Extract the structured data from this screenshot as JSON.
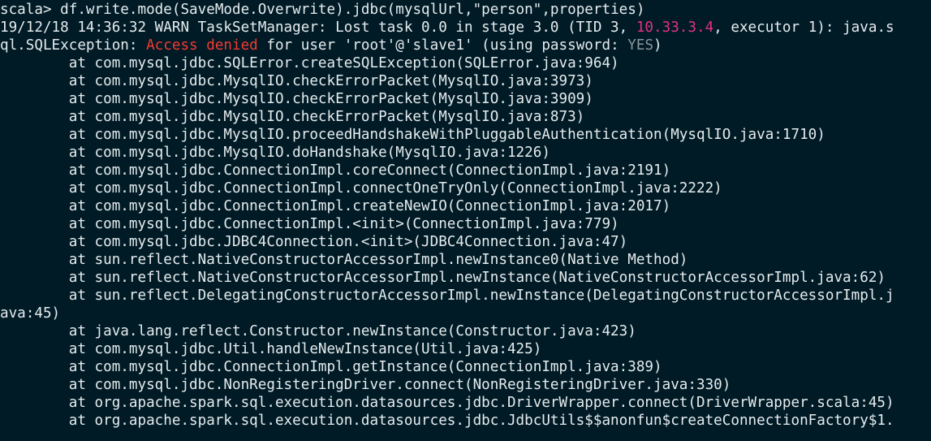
{
  "terminal": {
    "prompt": "scala>",
    "command": " df.write.mode(SaveMode.Overwrite).jdbc(mysqlUrl,\"person\",properties)",
    "warn_line": {
      "prefix": "19/12/18 14:36:32 WARN TaskSetManager: Lost task 0.0 in stage 3.0 (TID 3, ",
      "host": "10.33.3.4",
      "suffix": ", executor 1): java.s"
    },
    "exception_line": {
      "prefix": "ql.SQLException: ",
      "access_denied": "Access denied",
      "middle": " for user 'root'@'slave1' (using password: ",
      "password_flag": "YES",
      "suffix": ")"
    },
    "stack_lines": [
      "        at com.mysql.jdbc.SQLError.createSQLException(SQLError.java:964)",
      "        at com.mysql.jdbc.MysqlIO.checkErrorPacket(MysqlIO.java:3973)",
      "        at com.mysql.jdbc.MysqlIO.checkErrorPacket(MysqlIO.java:3909)",
      "        at com.mysql.jdbc.MysqlIO.checkErrorPacket(MysqlIO.java:873)",
      "        at com.mysql.jdbc.MysqlIO.proceedHandshakeWithPluggableAuthentication(MysqlIO.java:1710)",
      "        at com.mysql.jdbc.MysqlIO.doHandshake(MysqlIO.java:1226)",
      "        at com.mysql.jdbc.ConnectionImpl.coreConnect(ConnectionImpl.java:2191)",
      "        at com.mysql.jdbc.ConnectionImpl.connectOneTryOnly(ConnectionImpl.java:2222)",
      "        at com.mysql.jdbc.ConnectionImpl.createNewIO(ConnectionImpl.java:2017)",
      "        at com.mysql.jdbc.ConnectionImpl.<init>(ConnectionImpl.java:779)",
      "        at com.mysql.jdbc.JDBC4Connection.<init>(JDBC4Connection.java:47)",
      "        at sun.reflect.NativeConstructorAccessorImpl.newInstance0(Native Method)",
      "        at sun.reflect.NativeConstructorAccessorImpl.newInstance(NativeConstructorAccessorImpl.java:62)",
      "        at sun.reflect.DelegatingConstructorAccessorImpl.newInstance(DelegatingConstructorAccessorImpl.j",
      "ava:45)",
      "        at java.lang.reflect.Constructor.newInstance(Constructor.java:423)",
      "        at com.mysql.jdbc.Util.handleNewInstance(Util.java:425)",
      "        at com.mysql.jdbc.ConnectionImpl.getInstance(ConnectionImpl.java:389)",
      "        at com.mysql.jdbc.NonRegisteringDriver.connect(NonRegisteringDriver.java:330)",
      "        at org.apache.spark.sql.execution.datasources.jdbc.DriverWrapper.connect(DriverWrapper.scala:45)",
      "        at org.apache.spark.sql.execution.datasources.jdbc.JdbcUtils$$anonfun$createConnectionFactory$1."
    ]
  },
  "colors": {
    "background": "#001b26",
    "foreground": "#e6ecee",
    "host_highlight": "#e2337f",
    "error_highlight": "#f43a31",
    "dim_text": "#8a9598"
  }
}
